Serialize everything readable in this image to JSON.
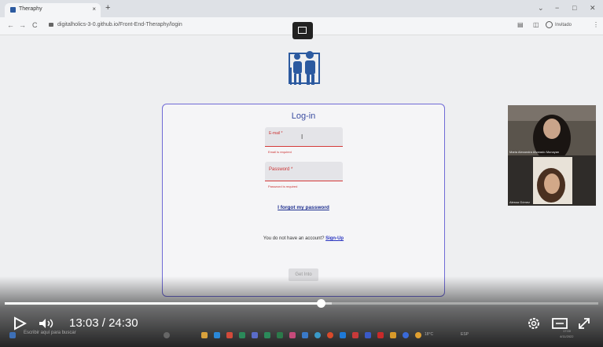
{
  "browser": {
    "tab_title": "Theraphy",
    "tab_close": "×",
    "new_tab": "+",
    "url": "digitalholics-3-0.github.io/Front-End-Theraphy/login",
    "profile_label": "Invitado",
    "nav_back": "←",
    "nav_forward": "→",
    "nav_reload": "C",
    "win_min": "−",
    "win_max": "□",
    "win_close": "✕",
    "tab_menu": "⌄"
  },
  "login": {
    "title": "Log-in",
    "email_label": "E-mail *",
    "email_error": "Email is required",
    "password_label": "Password *",
    "password_error": "Password is required",
    "forgot": "I forgot my password",
    "no_account": "You do not have an account?",
    "signup": "Sign-Up",
    "submit": "Get Into"
  },
  "participants": [
    {
      "name": "Maria Alexandra Alvarado Munayan"
    },
    {
      "name": "Alessa Gómez"
    }
  ],
  "player": {
    "current_time": "13:03",
    "separator": "/",
    "duration": "24:30",
    "progress_fraction": 0.532
  },
  "taskbar": {
    "search_placeholder": "Escribir aquí para buscar",
    "temperature": "18°C",
    "clock_time": "17:00",
    "clock_date": "4/11/2022",
    "lang": "ESP"
  },
  "colors": {
    "card_border": "#6f6ad6",
    "error": "#d53a3a",
    "link": "#2a35c0",
    "logo": "#2c5aa0"
  }
}
